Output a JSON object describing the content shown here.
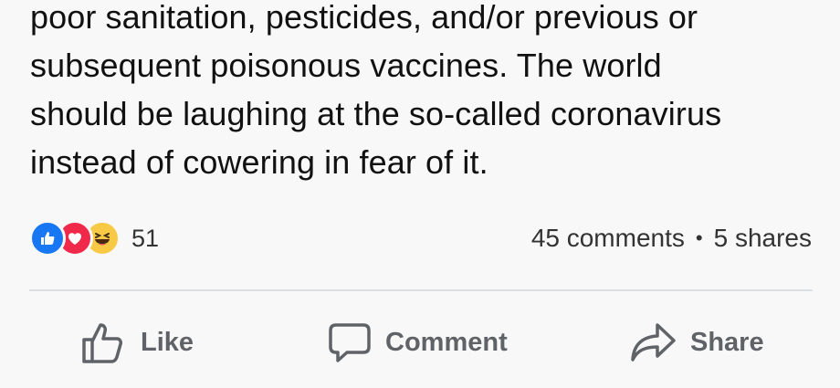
{
  "post": {
    "text_lines": [
      "poor sanitation, pesticides, and/or previous or",
      "subsequent poisonous vaccines. The world",
      "should be laughing at the so-called coronavirus",
      "instead of cowering in fear of it."
    ]
  },
  "reactions": {
    "icons": [
      "like-icon",
      "love-icon",
      "haha-icon"
    ],
    "count": "51",
    "colors": {
      "like": "#1877f2",
      "love": "#f02849",
      "haha": "#f7c944"
    }
  },
  "stats": {
    "comments": "45 comments",
    "separator": "•",
    "shares": "5 shares"
  },
  "actions": {
    "like_label": "Like",
    "comment_label": "Comment",
    "share_label": "Share"
  }
}
